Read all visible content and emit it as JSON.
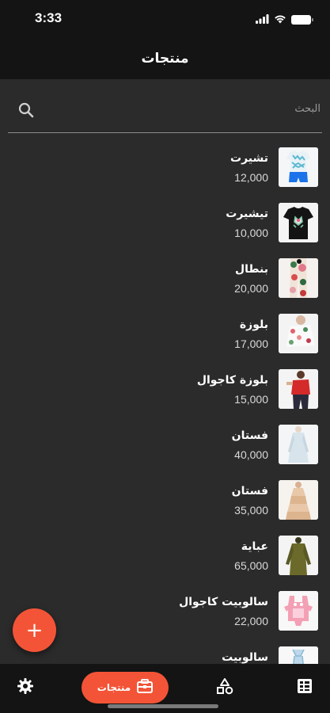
{
  "status_bar": {
    "time": "3:33"
  },
  "header": {
    "title": "منتجات"
  },
  "search": {
    "placeholder": "البحث"
  },
  "products": [
    {
      "name": "تشيرت",
      "price": "12,000"
    },
    {
      "name": "تيشيرت",
      "price": "10,000"
    },
    {
      "name": "بنطال",
      "price": "20,000"
    },
    {
      "name": "بلوزة",
      "price": "17,000"
    },
    {
      "name": "بلوزة كاجوال",
      "price": "15,000"
    },
    {
      "name": "فستان",
      "price": "40,000"
    },
    {
      "name": "فستان",
      "price": "35,000"
    },
    {
      "name": "عباية",
      "price": "65,000"
    },
    {
      "name": "سالوبيت كاجوال",
      "price": "22,000"
    },
    {
      "name": "سالوبيت",
      "price": ""
    }
  ],
  "fab": {
    "label": "+"
  },
  "bottom_nav": {
    "active_label": "منتجات",
    "items": [
      "settings-icon",
      "products-icon",
      "categories-icon",
      "orders-icon"
    ]
  },
  "colors": {
    "accent": "#f35437",
    "background": "#2b2b2b",
    "bar": "#141414"
  }
}
